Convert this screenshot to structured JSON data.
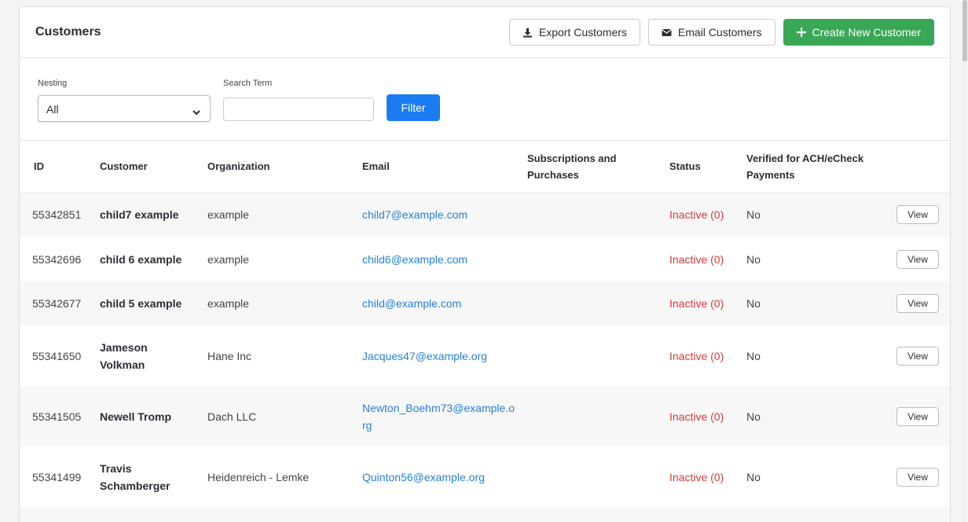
{
  "header": {
    "title": "Customers",
    "export_label": "Export Customers",
    "email_label": "Email Customers",
    "create_label": "Create New Customer"
  },
  "filters": {
    "nesting_label": "Nesting",
    "nesting_value": "All",
    "search_label": "Search Term",
    "search_value": "",
    "filter_label": "Filter"
  },
  "table": {
    "columns": [
      "ID",
      "Customer",
      "Organization",
      "Email",
      "Subscriptions and Purchases",
      "Status",
      "Verified for ACH/eCheck Payments"
    ],
    "view_label": "View",
    "rows": [
      {
        "id": "55342851",
        "customer": "child7 example",
        "organization": "example",
        "email": "child7@example.com",
        "subscriptions": "",
        "status": "Inactive (0)",
        "verified": "No"
      },
      {
        "id": "55342696",
        "customer": "child 6 example",
        "organization": "example",
        "email": "child6@example.com",
        "subscriptions": "",
        "status": "Inactive (0)",
        "verified": "No"
      },
      {
        "id": "55342677",
        "customer": "child 5 example",
        "organization": "example",
        "email": "child@example.com",
        "subscriptions": "",
        "status": "Inactive (0)",
        "verified": "No"
      },
      {
        "id": "55341650",
        "customer": "Jameson Volkman",
        "organization": "Hane Inc",
        "email": "Jacques47@example.org",
        "subscriptions": "",
        "status": "Inactive (0)",
        "verified": "No"
      },
      {
        "id": "55341505",
        "customer": "Newell Tromp",
        "organization": "Dach LLC",
        "email": "Newton_Boehm73@example.org",
        "subscriptions": "",
        "status": "Inactive (0)",
        "verified": "No"
      },
      {
        "id": "55341499",
        "customer": "Travis Schamberger",
        "organization": "Heidenreich - Lemke",
        "email": "Quinton56@example.org",
        "subscriptions": "",
        "status": "Inactive (0)",
        "verified": "No"
      }
    ]
  },
  "colors": {
    "primary": "#1a7cf0",
    "success": "#3aa757",
    "link": "#2680d9",
    "danger": "#d93a3a"
  }
}
